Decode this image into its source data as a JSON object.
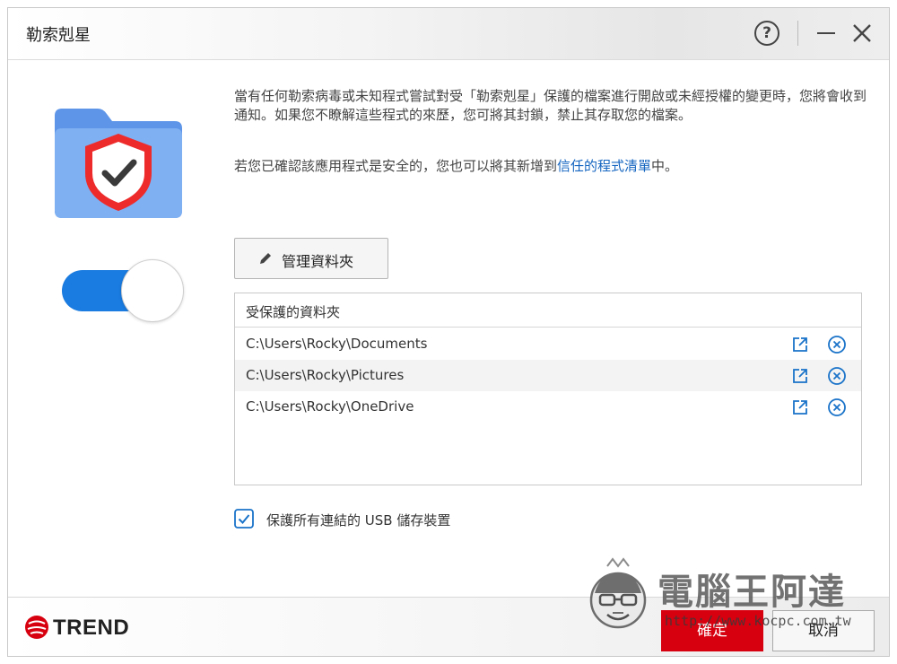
{
  "window": {
    "title": "勒索剋星",
    "help_symbol": "?"
  },
  "description": {
    "paragraph1": "當有任何勒索病毒或未知程式嘗試對受「勒索剋星」保護的檔案進行開啟或未經授權的變更時，您將會收到通知。如果您不瞭解這些程式的來歷，您可將其封鎖，禁止其存取您的檔案。",
    "paragraph2_prefix": "若您已確認該應用程式是安全的，您也可以將其新增到",
    "paragraph2_link": "信任的程式清單",
    "paragraph2_suffix": "中。"
  },
  "toggle": {
    "state": "on",
    "accent": "#1a7be0"
  },
  "manage_button": {
    "label": "管理資料夾",
    "icon": "pencil-icon"
  },
  "folder_list": {
    "header": "受保護的資料夾",
    "rows": [
      {
        "path": "C:\\Users\\Rocky\\Documents"
      },
      {
        "path": "C:\\Users\\Rocky\\Pictures"
      },
      {
        "path": "C:\\Users\\Rocky\\OneDrive"
      }
    ],
    "row_icons": [
      "open-external-icon",
      "remove-circle-icon"
    ]
  },
  "usb_option": {
    "checked": true,
    "label": "保護所有連結的 USB 儲存裝置"
  },
  "footer": {
    "brand": "TREND",
    "ok_label": "確定",
    "cancel_label": "取消",
    "ok_color": "#d7000f"
  },
  "watermark": {
    "title": "電腦王阿達",
    "url": "http://www.kocpc.com.tw"
  }
}
